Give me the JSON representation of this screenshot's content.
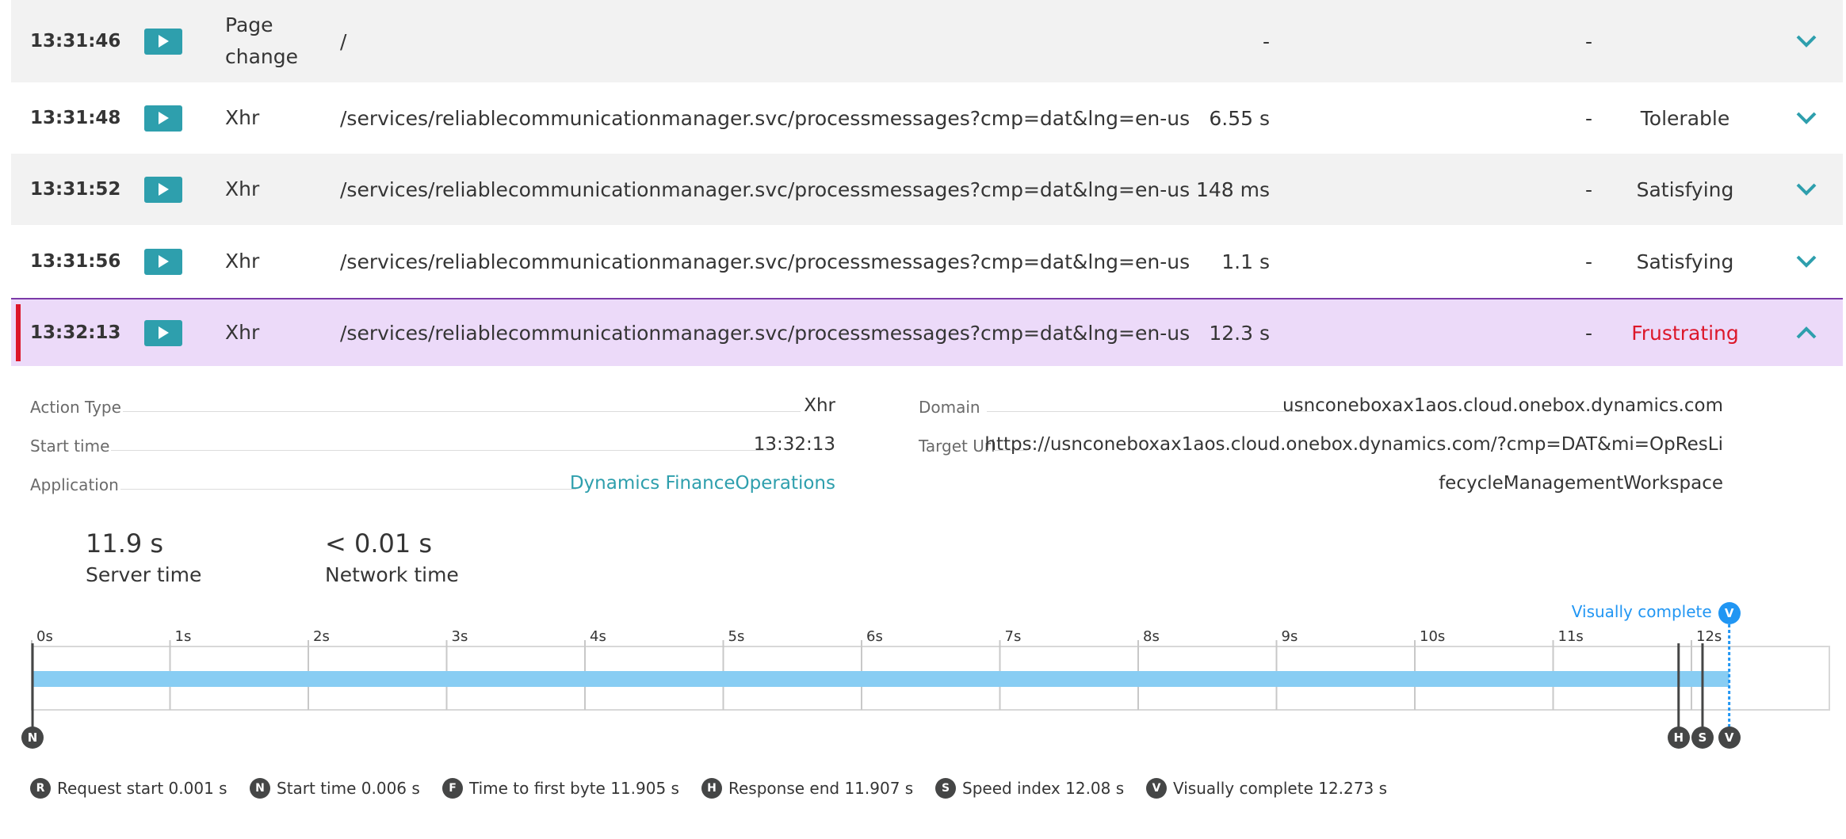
{
  "actions": [
    {
      "time": "13:31:46",
      "type": "Page change",
      "url": "/",
      "duration": "-",
      "extra": "-",
      "rating": "",
      "expanded": false
    },
    {
      "time": "13:31:48",
      "type": "Xhr",
      "url": "/services/reliablecommunicationmanager.svc/processmessages?cmp=dat&lng=en-us",
      "duration": "6.55 s",
      "extra": "-",
      "rating": "Tolerable",
      "expanded": false
    },
    {
      "time": "13:31:52",
      "type": "Xhr",
      "url": "/services/reliablecommunicationmanager.svc/processmessages?cmp=dat&lng=en-us",
      "duration": "148 ms",
      "extra": "-",
      "rating": "Satisfying",
      "expanded": false
    },
    {
      "time": "13:31:56",
      "type": "Xhr",
      "url": "/services/reliablecommunicationmanager.svc/processmessages?cmp=dat&lng=en-us",
      "duration": "1.1 s",
      "extra": "-",
      "rating": "Satisfying",
      "expanded": false
    },
    {
      "time": "13:32:13",
      "type": "Xhr",
      "url": "/services/reliablecommunicationmanager.svc/processmessages?cmp=dat&lng=en-us",
      "duration": "12.3 s",
      "extra": "-",
      "rating": "Frustrating",
      "expanded": true
    }
  ],
  "icons": {
    "play": "play-icon",
    "expand": "chevron-down-icon",
    "collapse": "chevron-up-icon"
  },
  "colors": {
    "accent": "#2e9fad",
    "selected_bg": "#ecdaf9",
    "frustrating": "#dc172a",
    "timeline_bar": "#88cdf3",
    "visually_complete": "#2196f3"
  },
  "details": {
    "action_type_label": "Action Type",
    "action_type": "Xhr",
    "start_time_label": "Start time",
    "start_time": "13:32:13",
    "application_label": "Application",
    "application": "Dynamics FinanceOperations",
    "domain_label": "Domain",
    "domain": "usnconeboxax1aos.cloud.onebox.dynamics.com",
    "target_url_label": "Target Url",
    "target_url_line1": "https://usnconeboxax1aos.cloud.onebox.dynamics.com/?cmp=DAT&mi=OpResLi",
    "target_url_line2": "fecycleManagementWorkspace"
  },
  "metrics": [
    {
      "value": "11.9 s",
      "label": "Server time"
    },
    {
      "value": "< 0.01 s",
      "label": "Network time"
    }
  ],
  "timeline": {
    "ticks": [
      "0s",
      "1s",
      "2s",
      "3s",
      "4s",
      "5s",
      "6s",
      "7s",
      "8s",
      "9s",
      "10s",
      "11s",
      "12s"
    ],
    "max_seconds": 13,
    "bar_start_s": 0.001,
    "bar_end_s": 12.273,
    "visually_complete_label": "Visually complete",
    "markers": [
      {
        "letter": "N",
        "at_s": 0.006
      },
      {
        "letter": "H",
        "at_s": 11.907
      },
      {
        "letter": "S",
        "at_s": 12.08
      },
      {
        "letter": "V",
        "at_s": 12.273
      }
    ]
  },
  "legend": [
    {
      "letter": "R",
      "text": "Request start 0.001 s"
    },
    {
      "letter": "N",
      "text": "Start time 0.006 s"
    },
    {
      "letter": "F",
      "text": "Time to first byte 11.905 s"
    },
    {
      "letter": "H",
      "text": "Response end 11.907 s"
    },
    {
      "letter": "S",
      "text": "Speed index 12.08 s"
    },
    {
      "letter": "V",
      "text": "Visually complete 12.273 s"
    }
  ]
}
